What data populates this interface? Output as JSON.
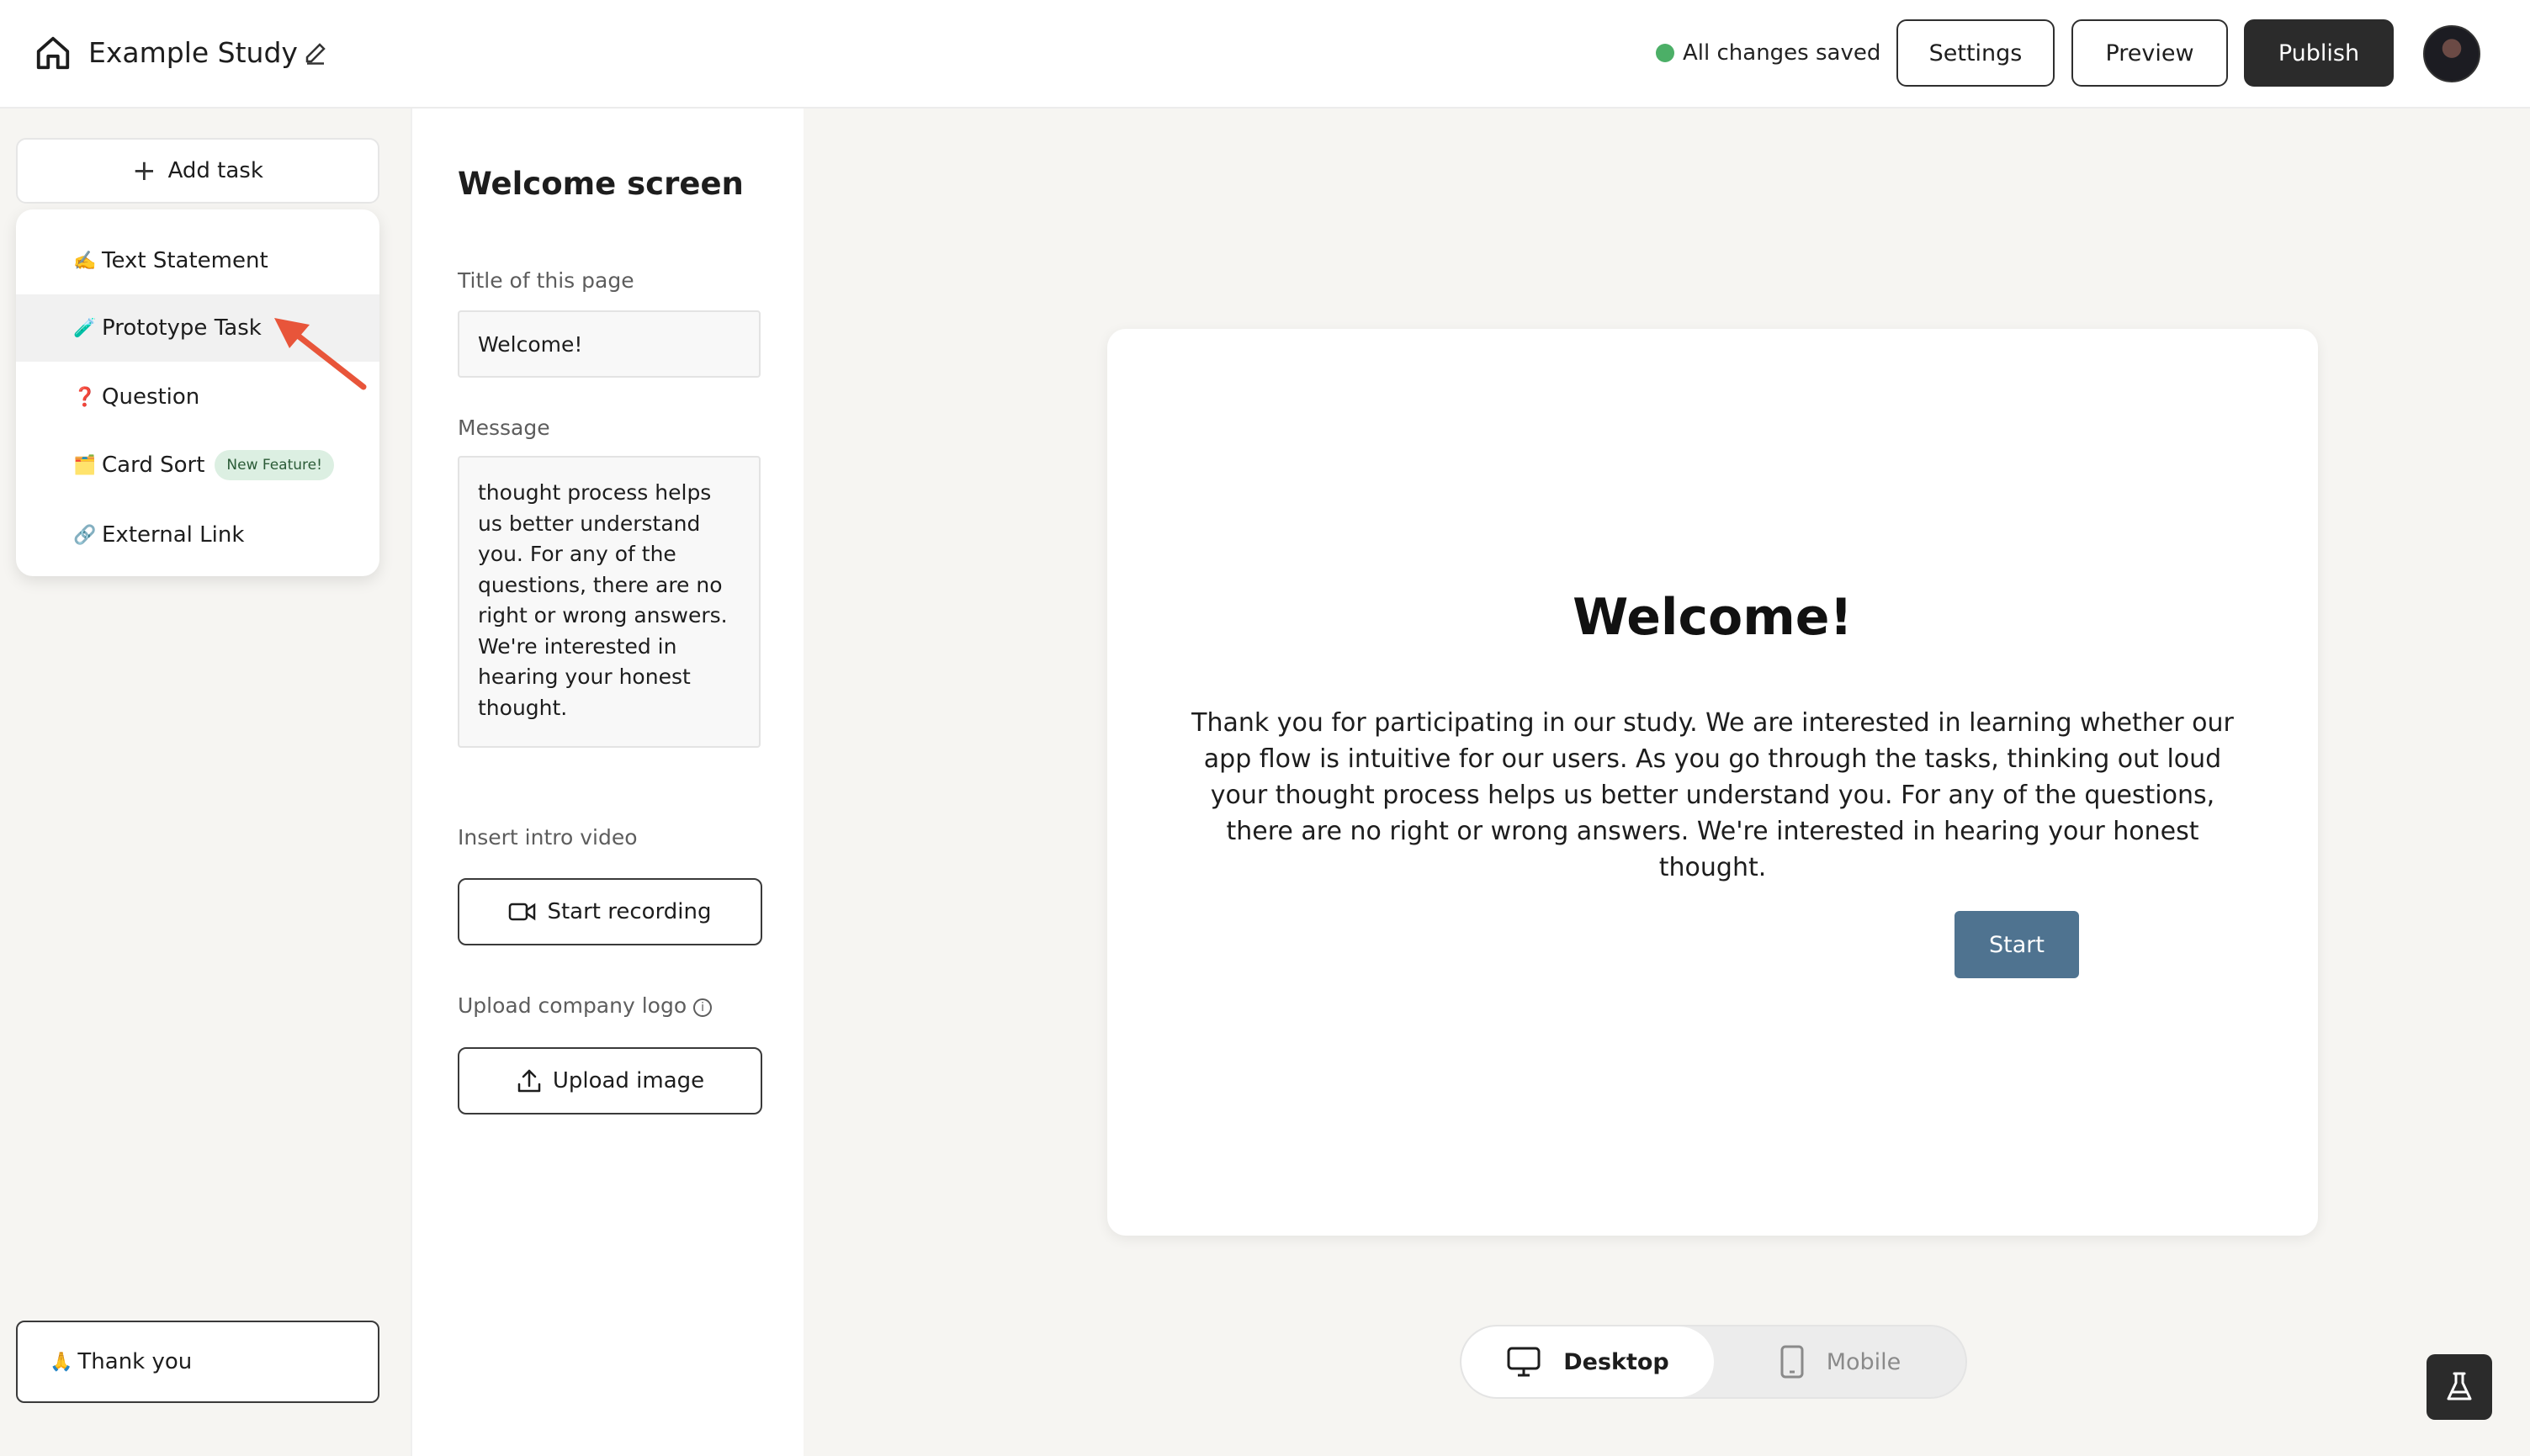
{
  "header": {
    "study_title": "Example Study",
    "status_text": "All changes saved",
    "status_color": "#4caf67",
    "settings_label": "Settings",
    "preview_label": "Preview",
    "publish_label": "Publish",
    "icons": {
      "home": "home-icon",
      "edit": "pencil-icon",
      "avatar": "user-avatar"
    }
  },
  "sidebar": {
    "add_task_label": "Add task",
    "task_types": [
      {
        "emoji": "✍️",
        "label": "Text Statement"
      },
      {
        "emoji": "🧪",
        "label": "Prototype Task"
      },
      {
        "emoji": "❓",
        "label": "Question"
      },
      {
        "emoji": "🗂️",
        "label": "Card Sort",
        "badge": "New Feature!"
      },
      {
        "emoji": "🔗",
        "label": "External Link"
      }
    ],
    "thank_you": {
      "emoji": "🙏",
      "label": "Thank you"
    }
  },
  "panel": {
    "heading": "Welcome screen",
    "title_label": "Title of this page",
    "title_value": "Welcome!",
    "message_label": "Message",
    "message_value": "thought process helps us better understand you. For any of the questions, there are no right or wrong answers. We're interested in hearing your honest thought.",
    "video_label": "Insert intro video",
    "record_label": "Start recording",
    "logo_label": "Upload company logo",
    "upload_label": "Upload image"
  },
  "preview": {
    "title": "Welcome!",
    "message": "Thank you for participating in our study. We are interested in learning whether our app flow is intuitive for our users. As you go through the tasks, thinking out loud your thought process helps us better understand you. For any of the questions, there are no right or wrong answers. We're interested in hearing your honest thought.",
    "start_label": "Start",
    "start_color": "#4f7390",
    "device_desktop": "Desktop",
    "device_mobile": "Mobile",
    "selected_device": "Desktop"
  },
  "colors": {
    "accent_dark": "#2b2b2b",
    "annotation_arrow": "#e8553a",
    "badge_bg": "#dcefe2"
  }
}
